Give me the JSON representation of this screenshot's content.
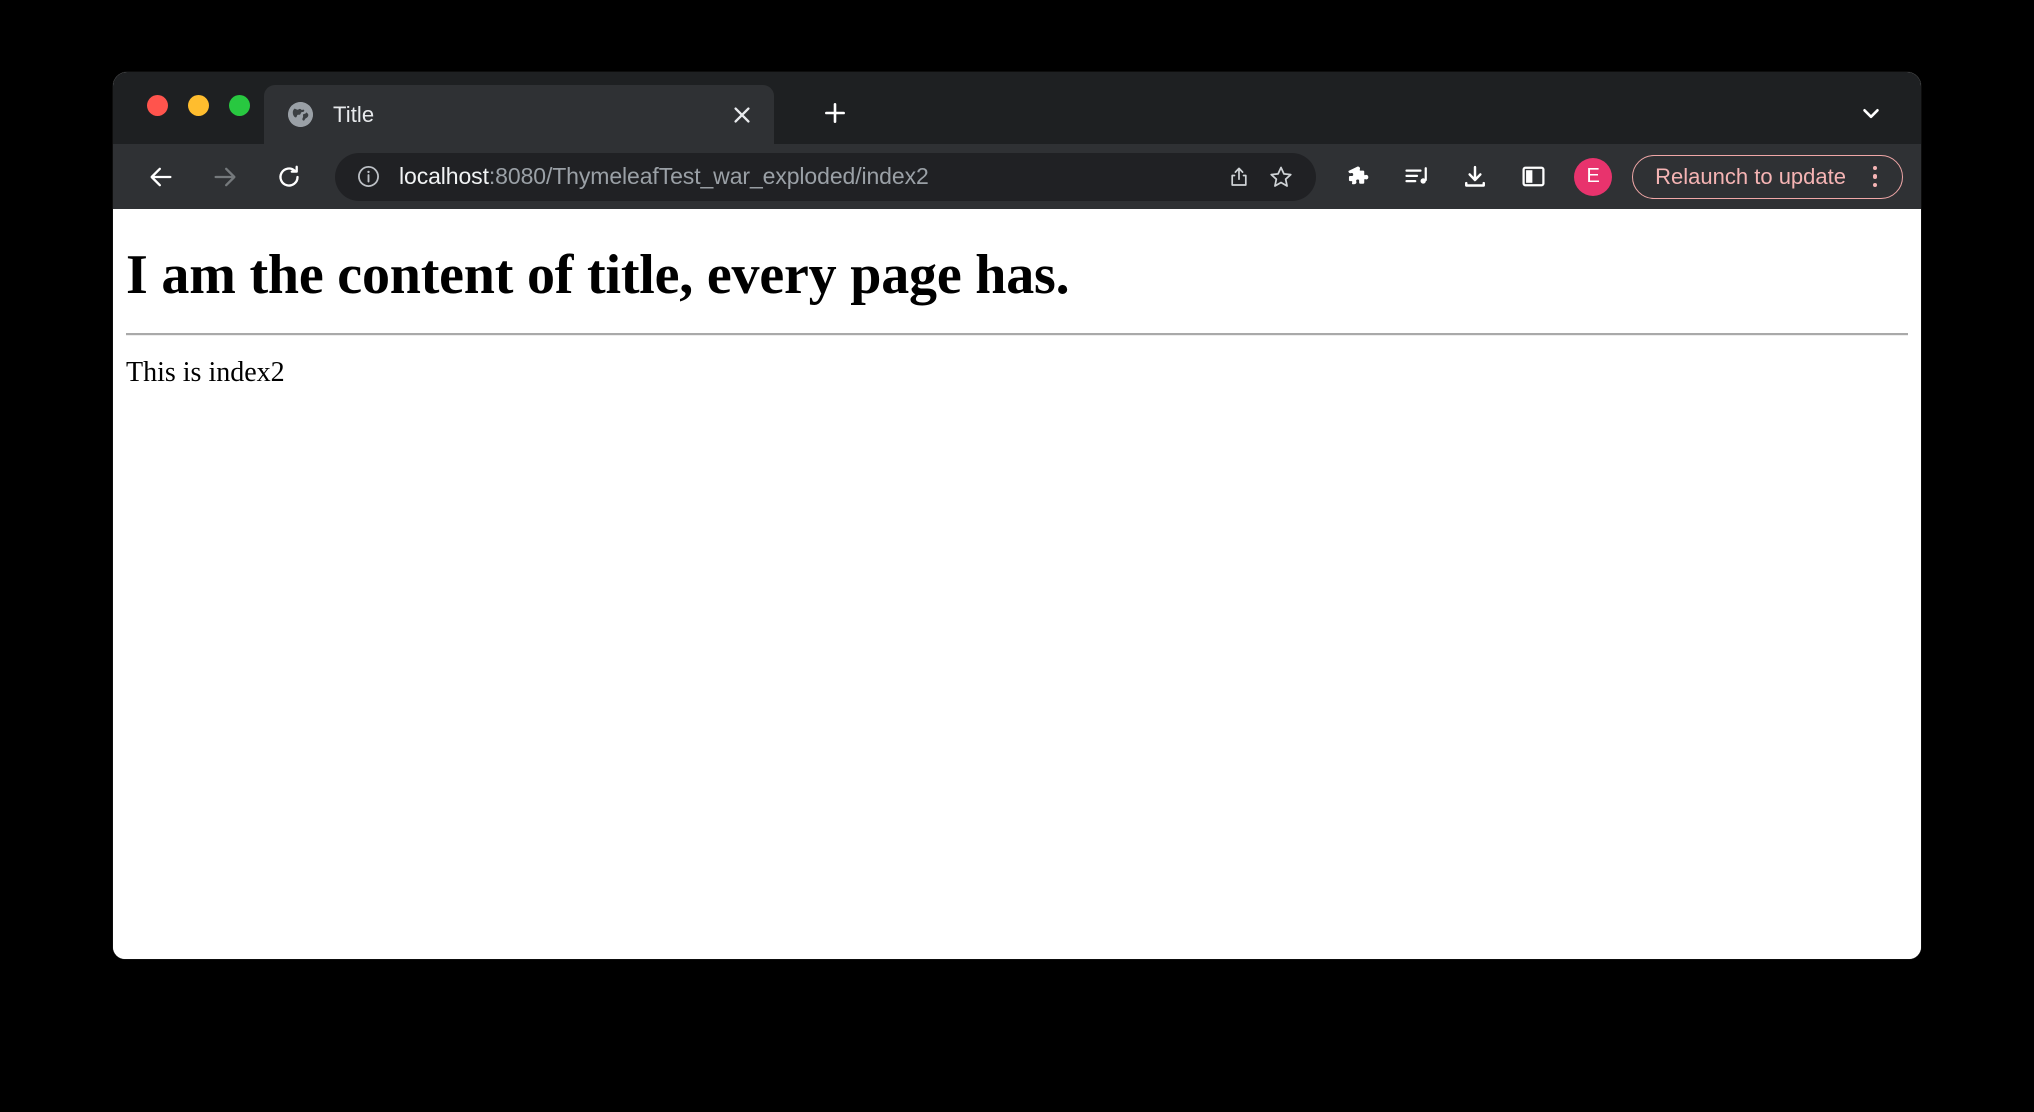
{
  "window": {
    "traffic_lights": [
      {
        "name": "close",
        "color": "#ff544d"
      },
      {
        "name": "minimize",
        "color": "#ffbd2e"
      },
      {
        "name": "maximize",
        "color": "#28c840"
      }
    ]
  },
  "tab_strip": {
    "active_tab": {
      "title": "Title",
      "favicon": "globe-icon",
      "close_icon": "close-icon"
    },
    "new_tab_icon": "plus-icon",
    "tab_search_icon": "chevron-down-icon"
  },
  "toolbar": {
    "back_icon": "arrow-left-icon",
    "forward_icon": "arrow-right-icon",
    "reload_icon": "reload-icon",
    "omnibox": {
      "info_icon": "info-circle-icon",
      "host": "localhost",
      "path": ":8080/ThymeleafTest_war_exploded/index2",
      "share_icon": "share-icon",
      "bookmark_icon": "star-icon"
    },
    "extensions_icon": "puzzle-icon",
    "media_icon": "playlist-music-icon",
    "downloads_icon": "download-icon",
    "side_panel_icon": "side-panel-icon",
    "profile": {
      "initial": "E",
      "color": "#e8336d"
    },
    "relaunch": {
      "label": "Relaunch to update",
      "menu_icon": "more-vertical-icon",
      "accent": "#f5b4b4"
    }
  },
  "page": {
    "heading": "I am the content of title, every page has.",
    "paragraph": "This is index2"
  }
}
